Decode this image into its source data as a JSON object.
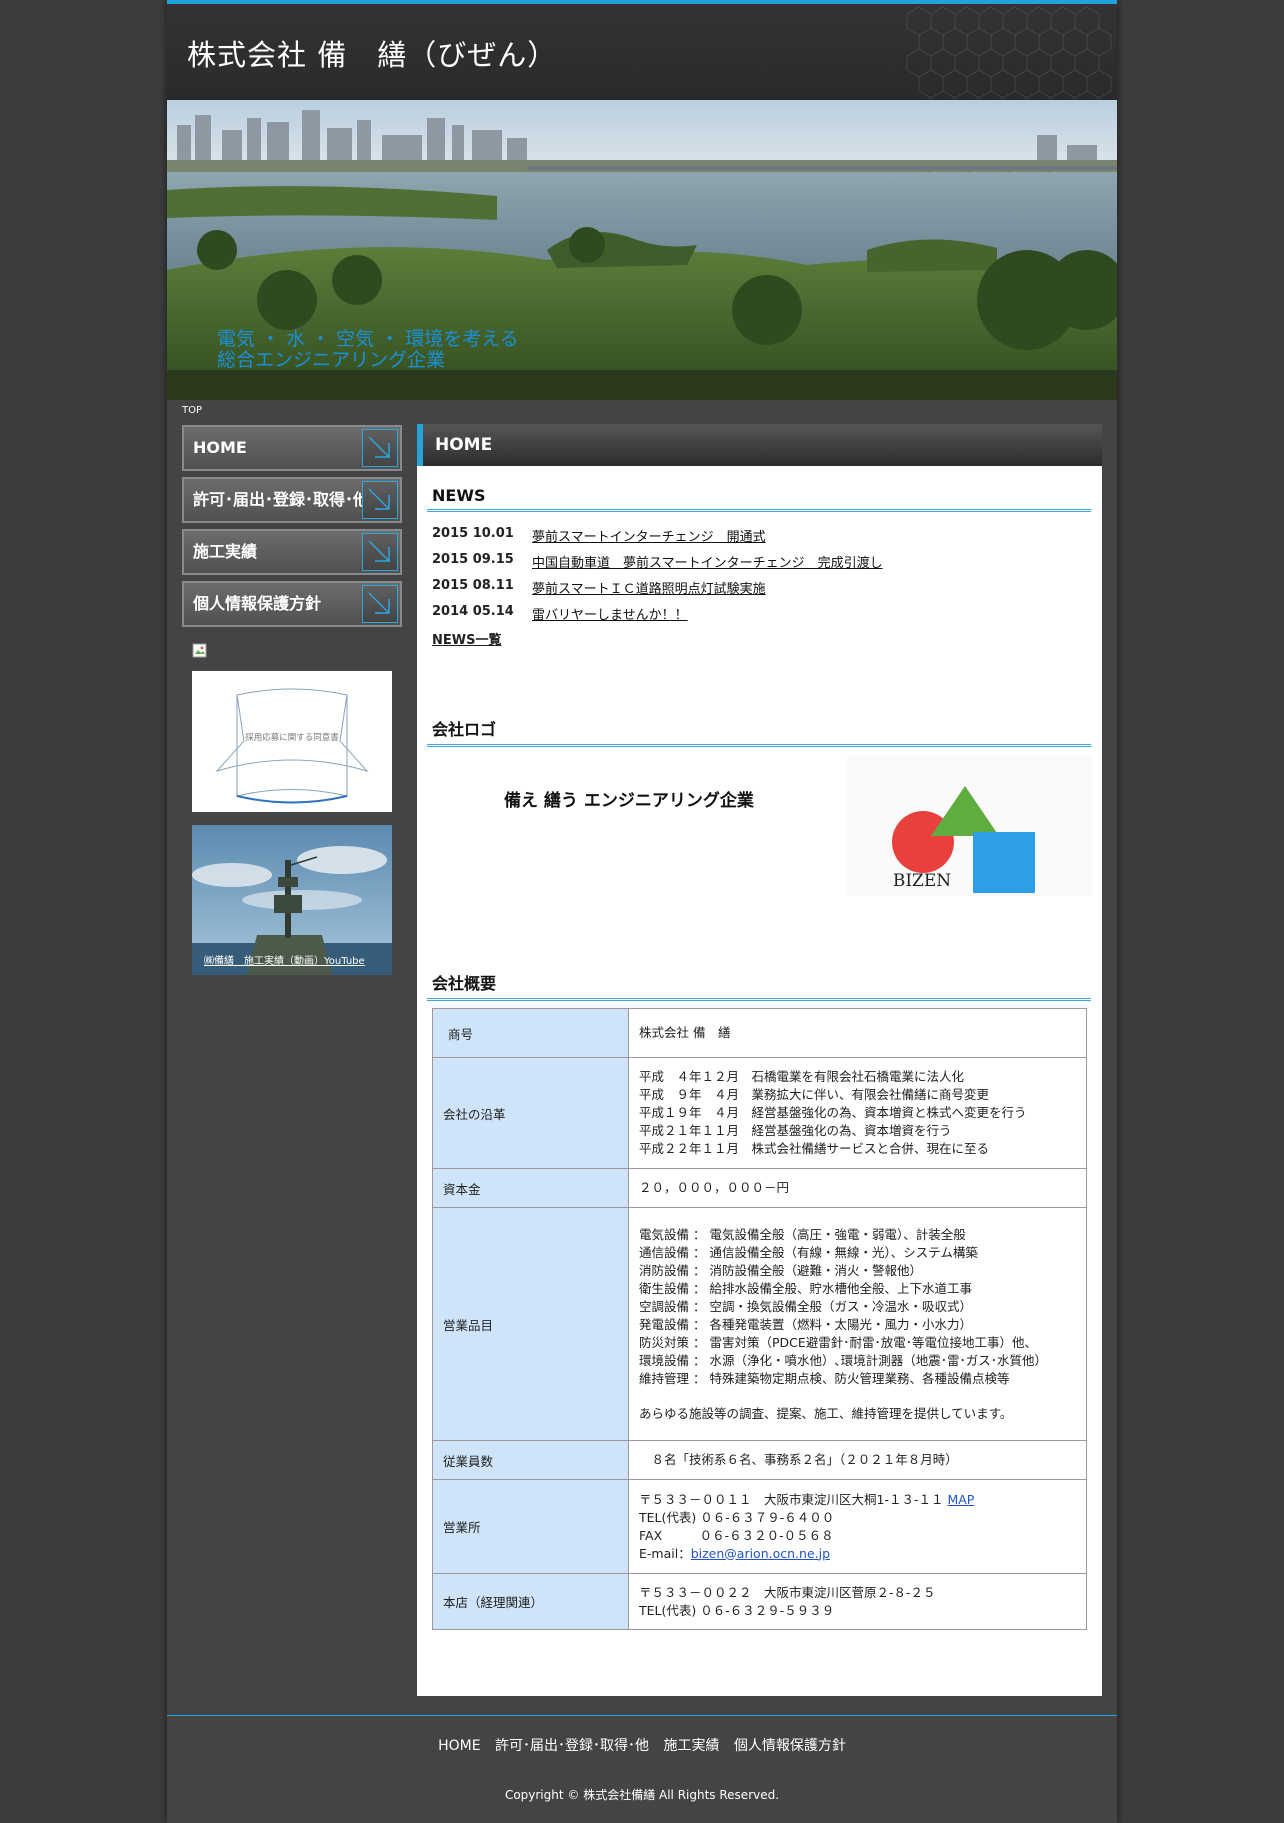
{
  "site": {
    "title": "株式会社 備　繕（びぜん）"
  },
  "hero": {
    "tagline_line1": "電気 ・ 水 ・ 空気 ・ 環境を考える",
    "tagline_line2": "総合エンジニアリング企業"
  },
  "breadcrumb": "TOP",
  "nav": {
    "items": [
      {
        "label": "HOME"
      },
      {
        "label": "許可･届出･登録･取得･他"
      },
      {
        "label": "施工実績"
      },
      {
        "label": "個人情報保護方針"
      }
    ]
  },
  "banners": {
    "consent": "採用応募に関する同意書",
    "video_caption": "㈱備繕　施工実績（動画）YouTube"
  },
  "content": {
    "page_title": "HOME",
    "news": {
      "title": "NEWS",
      "items": [
        {
          "date": "2015 10.01",
          "text": "夢前スマートインターチェンジ　開通式"
        },
        {
          "date": "2015 09.15",
          "text": "中国自動車道　夢前スマートインターチェンジ　完成引渡し"
        },
        {
          "date": "2015 08.11",
          "text": "夢前スマートＩＣ道路照明点灯試験実施"
        },
        {
          "date": "2014 05.14",
          "text": "雷バリヤーしませんか！！"
        }
      ],
      "all_link": "NEWS一覧"
    },
    "logo": {
      "title": "会社ロゴ",
      "slogan": "備え 繕う エンジニアリング企業",
      "brand": "BIZEN"
    },
    "overview": {
      "title": "会社概要",
      "rows": {
        "name": {
          "key": "商号",
          "value": "株式会社 備　繕"
        },
        "history": {
          "key": "会社の沿革",
          "lines": [
            "平成　４年１２月　石橋電業を有限会社石橋電業に法人化",
            "平成　９年　４月　業務拡大に伴い、有限会社備繕に商号変更",
            "平成１９年　４月　経営基盤強化の為、資本増資と株式へ変更を行う",
            "平成２１年１１月　経営基盤強化の為、資本増資を行う",
            "平成２２年１１月　株式会社備繕サービスと合併、現在に至る"
          ]
        },
        "capital": {
          "key": "資本金",
          "value": "２０，０００，０００－円"
        },
        "business": {
          "key": "営業品目",
          "lines": [
            "電気設備 ： 電気設備全般（高圧・強電・弱電）、計装全般",
            "通信設備 ： 通信設備全般（有線・無線・光）、システム構築",
            "消防設備 ： 消防設備全般（避難・消火・警報他）",
            "衛生設備 ： 給排水設備全般、貯水槽他全般、上下水道工事",
            "空調設備 ： 空調・換気設備全般（ガス・冷温水・吸収式）",
            "発電設備 ： 各種発電装置（燃料・太陽光・風力・小水力）",
            "防災対策 ： 雷害対策（PDCE避雷針･耐雷･放電･等電位接地工事）他、",
            "環境設備 ： 水源（浄化・噴水他）､環境計測器（地震･雷･ガス･水質他）",
            "維持管理 ： 特殊建築物定期点検、防火管理業務、各種設備点検等"
          ],
          "note": "あらゆる施設等の調査、提案、施工、維持管理を提供しています。"
        },
        "employees": {
          "key": "従業員数",
          "value": "　８名「技術系６名、事務系２名」（２０２１年８月時）"
        },
        "office": {
          "key": "営業所",
          "address": "〒５３３－００１１　大阪市東淀川区大桐1-１３-１１",
          "map": "MAP",
          "tel": "TEL(代表) ０６-６３７９-６４００",
          "fax": "FAX　　　０６-６３２０-０５６８",
          "email_label": "E-mail：",
          "email": "bizen@arion.ocn.ne.jp"
        },
        "headoffice": {
          "key": "本店（経理関連）",
          "address": "〒５３３－００２２　大阪市東淀川区菅原２-８-２５",
          "tel": "TEL(代表) ０６-６３２９-５９３９"
        }
      }
    }
  },
  "footer": {
    "nav": [
      "HOME",
      "許可･届出･登録･取得･他",
      "施工実績",
      "個人情報保護方針"
    ],
    "copyright": "Copyright © 株式会社備繕 All Rights Reserved."
  },
  "colors": {
    "accent": "#1fa3d8",
    "table_key_bg": "#cfe4f8",
    "tagline": "#1b8fd6"
  }
}
